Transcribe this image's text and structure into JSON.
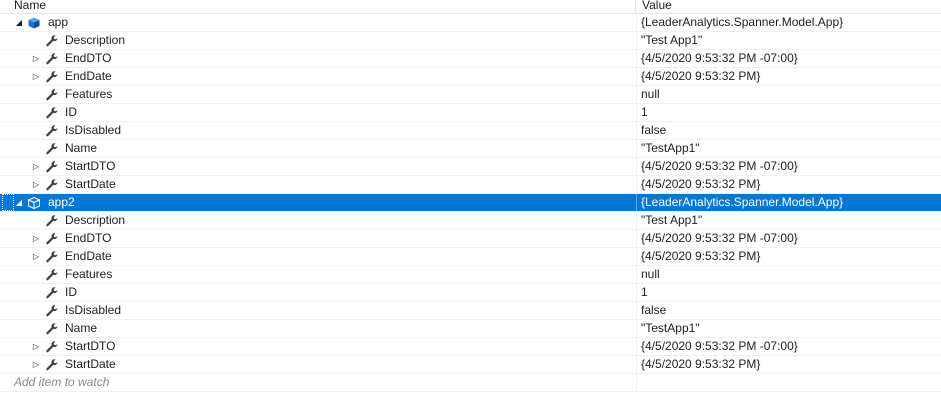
{
  "header": {
    "name_col": "Name",
    "value_col": "Value"
  },
  "rows": [
    {
      "depth": 0,
      "expander": "open",
      "icon": "object-icon",
      "name": "app",
      "value": "{LeaderAnalytics.Spanner.Model.App}",
      "selected": false
    },
    {
      "depth": 1,
      "expander": "none",
      "icon": "wrench-icon",
      "name": "Description",
      "value": "\"Test App1\"",
      "selected": false
    },
    {
      "depth": 1,
      "expander": "closed",
      "icon": "wrench-icon",
      "name": "EndDTO",
      "value": "{4/5/2020 9:53:32 PM -07:00}",
      "selected": false
    },
    {
      "depth": 1,
      "expander": "closed",
      "icon": "wrench-icon",
      "name": "EndDate",
      "value": "{4/5/2020 9:53:32 PM}",
      "selected": false
    },
    {
      "depth": 1,
      "expander": "none",
      "icon": "wrench-icon",
      "name": "Features",
      "value": "null",
      "selected": false
    },
    {
      "depth": 1,
      "expander": "none",
      "icon": "wrench-icon",
      "name": "ID",
      "value": "1",
      "selected": false
    },
    {
      "depth": 1,
      "expander": "none",
      "icon": "wrench-icon",
      "name": "IsDisabled",
      "value": "false",
      "selected": false
    },
    {
      "depth": 1,
      "expander": "none",
      "icon": "wrench-icon",
      "name": "Name",
      "value": "\"TestApp1\"",
      "selected": false
    },
    {
      "depth": 1,
      "expander": "closed",
      "icon": "wrench-icon",
      "name": "StartDTO",
      "value": "{4/5/2020 9:53:32 PM -07:00}",
      "selected": false
    },
    {
      "depth": 1,
      "expander": "closed",
      "icon": "wrench-icon",
      "name": "StartDate",
      "value": "{4/5/2020 9:53:32 PM}",
      "selected": false
    },
    {
      "depth": 0,
      "expander": "open",
      "icon": "object-icon",
      "name": "app2",
      "value": "{LeaderAnalytics.Spanner.Model.App}",
      "selected": true
    },
    {
      "depth": 1,
      "expander": "none",
      "icon": "wrench-icon",
      "name": "Description",
      "value": "\"Test App1\"",
      "selected": false
    },
    {
      "depth": 1,
      "expander": "closed",
      "icon": "wrench-icon",
      "name": "EndDTO",
      "value": "{4/5/2020 9:53:32 PM -07:00}",
      "selected": false
    },
    {
      "depth": 1,
      "expander": "closed",
      "icon": "wrench-icon",
      "name": "EndDate",
      "value": "{4/5/2020 9:53:32 PM}",
      "selected": false
    },
    {
      "depth": 1,
      "expander": "none",
      "icon": "wrench-icon",
      "name": "Features",
      "value": "null",
      "selected": false
    },
    {
      "depth": 1,
      "expander": "none",
      "icon": "wrench-icon",
      "name": "ID",
      "value": "1",
      "selected": false
    },
    {
      "depth": 1,
      "expander": "none",
      "icon": "wrench-icon",
      "name": "IsDisabled",
      "value": "false",
      "selected": false
    },
    {
      "depth": 1,
      "expander": "none",
      "icon": "wrench-icon",
      "name": "Name",
      "value": "\"TestApp1\"",
      "selected": false
    },
    {
      "depth": 1,
      "expander": "closed",
      "icon": "wrench-icon",
      "name": "StartDTO",
      "value": "{4/5/2020 9:53:32 PM -07:00}",
      "selected": false
    },
    {
      "depth": 1,
      "expander": "closed",
      "icon": "wrench-icon",
      "name": "StartDate",
      "value": "{4/5/2020 9:53:32 PM}",
      "selected": false
    }
  ],
  "add_item_placeholder": "Add item to watch",
  "colors": {
    "selection": "#0078d7",
    "object_icon": "#1c71c7",
    "wrench_icon": "#424242"
  }
}
